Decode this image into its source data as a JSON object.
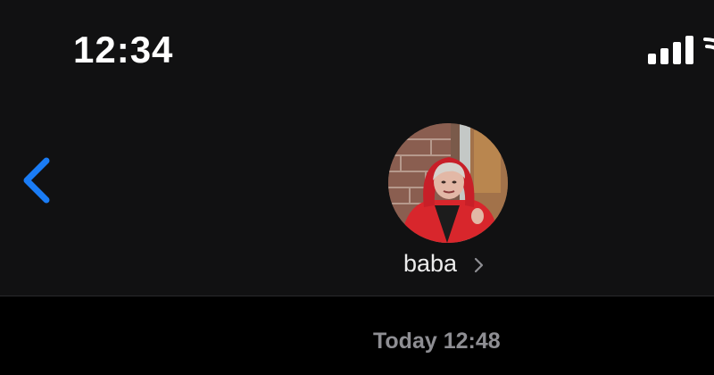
{
  "status_bar": {
    "time": "12:34",
    "signal_icon": "cellular-signal-icon",
    "wifi_icon": "wifi-icon"
  },
  "nav": {
    "back_icon": "chevron-left-icon",
    "accent_color": "#1a7cf5"
  },
  "contact": {
    "name": "baba",
    "avatar_icon": "contact-avatar-photo",
    "chevron_icon": "chevron-right-icon"
  },
  "conversation": {
    "timestamp": "Today 12:48"
  },
  "colors": {
    "header_bg": "#111112",
    "body_bg": "#000000",
    "text_primary": "#ffffff",
    "text_secondary": "#8e8e93"
  }
}
